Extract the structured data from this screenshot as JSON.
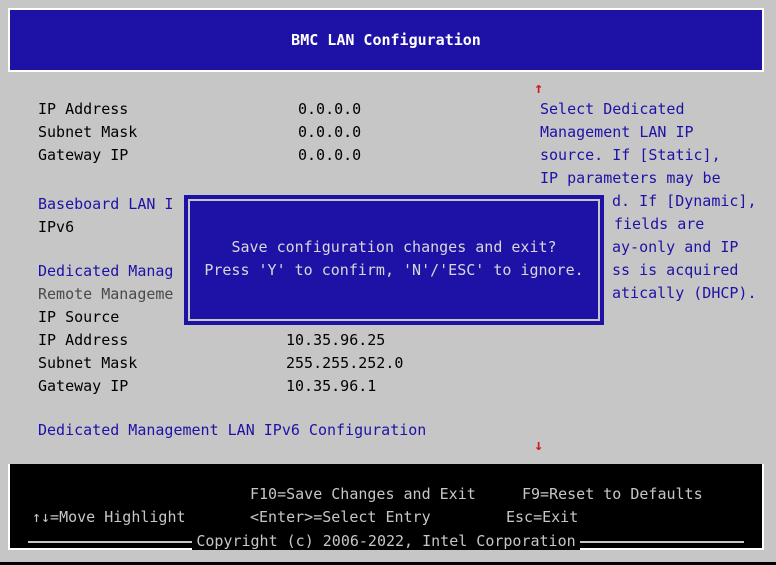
{
  "title": "BMC LAN Configuration",
  "lan1": {
    "ip_address_label": "IP Address",
    "ip_address_value": "0.0.0.0",
    "subnet_mask_label": "Subnet Mask",
    "subnet_mask_value": "0.0.0.0",
    "gateway_ip_label": "Gateway IP",
    "gateway_ip_value": "0.0.0.0"
  },
  "baseboard_header": "Baseboard LAN I",
  "ipv6_label": "IPv6",
  "dedicated_header": "Dedicated Manag",
  "remote_label": "Remote Manageme",
  "lan2": {
    "ip_source_label": "IP Source",
    "ip_address_label": "IP Address",
    "ip_address_value": "10.35.96.25",
    "subnet_mask_label": "Subnet Mask",
    "subnet_mask_value": "255.255.252.0",
    "gateway_ip_label": "Gateway IP",
    "gateway_ip_value": "10.35.96.1"
  },
  "ipv6_header": "Dedicated Management LAN IPv6 Configuration",
  "help": [
    "Select Dedicated",
    "Management LAN IP",
    "source. If [Static],",
    "IP parameters may be",
    "d. If [Dynamic],",
    "fields are",
    "ay-only and IP",
    "ss is acquired",
    "atically (DHCP)."
  ],
  "scroll": {
    "up": "↑",
    "down": "↓"
  },
  "dialog": {
    "line1": "Save configuration changes and exit?",
    "line2": "Press 'Y' to confirm, 'N'/'ESC' to ignore."
  },
  "keys": {
    "f10": "F10=Save Changes and Exit",
    "f9": "F9=Reset to Defaults",
    "move": "↑↓=Move Highlight",
    "enter": "<Enter>=Select Entry",
    "esc": "Esc=Exit"
  },
  "copyright": "Copyright (c) 2006-2022, Intel Corporation"
}
